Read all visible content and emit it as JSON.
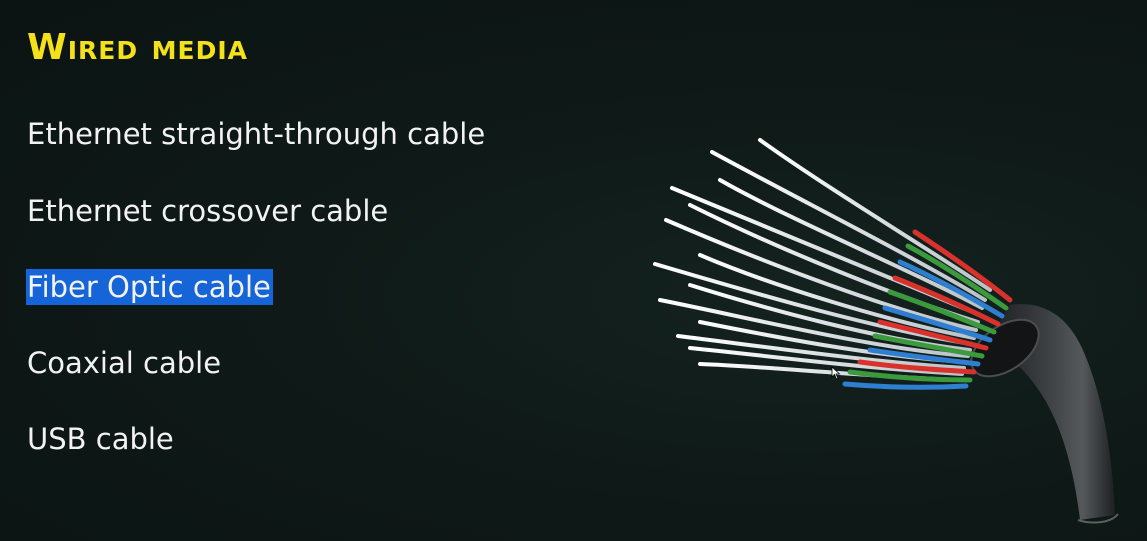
{
  "slide": {
    "title": "Wired media",
    "items": [
      {
        "label": "Ethernet straight-through cable",
        "selected": false
      },
      {
        "label": "Ethernet crossover cable",
        "selected": false
      },
      {
        "label": "Fiber Optic cable",
        "selected": true
      },
      {
        "label": "Coaxial cable",
        "selected": false
      },
      {
        "label": "USB cable",
        "selected": false
      }
    ]
  },
  "illustration": {
    "subject": "fiber-optic-cable-icon"
  },
  "colors": {
    "background": "#0f1a18",
    "title": "#f4e11a",
    "text": "#f2f2f2",
    "selection": "#1565d8",
    "fiber_red": "#d8322c",
    "fiber_green": "#3a9a3c",
    "fiber_blue": "#2f7fd0",
    "jacket": "#2b2e30"
  }
}
